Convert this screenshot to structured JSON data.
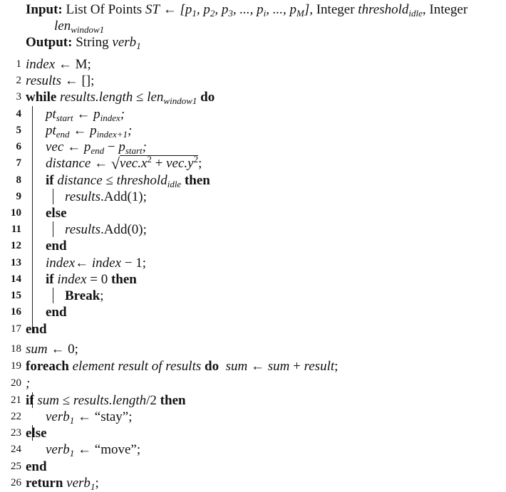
{
  "header": {
    "input_label": "Input:",
    "input_text_1": "List Of Points",
    "input_var_st": "ST",
    "arrow": "←",
    "points_list": "[p",
    "p1_sub": "1",
    "p2": ", p",
    "p2_sub": "2",
    "p3": ", p",
    "p3_sub": "3",
    "p_ellipsis1": ", ..., p",
    "pi_sub": "i",
    "p_ellipsis2": ", ..., p",
    "pm_sub": "M",
    "points_close": "],",
    "input_text_2": "Integer",
    "threshold_var": "threshold",
    "threshold_sub": "idle",
    "comma": ",",
    "input_text_3": "Integer",
    "len_var": "len",
    "len_sub": "window1",
    "output_label": "Output:",
    "output_text": "String",
    "verb_var": "verb",
    "verb_sub": "1"
  },
  "lines": [
    {
      "num": "1",
      "parts": {
        "a": "index",
        "b": "← M;"
      }
    },
    {
      "num": "2",
      "parts": {
        "a": "results",
        "b": "← [];"
      }
    },
    {
      "num": "3",
      "parts": {
        "kw1": "while",
        "a": "results.length",
        "b": "≤",
        "c": "len",
        "c_sub": "window1",
        "kw2": "do"
      }
    },
    {
      "num": "4",
      "parts": {
        "a": "pt",
        "a_sub": "start",
        "b": "←",
        "c": "p",
        "c_sub": "index",
        "d": ";"
      }
    },
    {
      "num": "5",
      "parts": {
        "a": "pt",
        "a_sub": "end",
        "b": "←",
        "c": "p",
        "c_sub": "index+1",
        "d": ";"
      }
    },
    {
      "num": "6",
      "parts": {
        "a": "vec",
        "b": "←",
        "c": "p",
        "c_sub": "end",
        "d": "−",
        "e": "p",
        "e_sub": "start",
        "f": ";"
      }
    },
    {
      "num": "7",
      "parts": {
        "a": "distance",
        "b": "←",
        "c": "vec.x",
        "c_sup": "2",
        "d": "+",
        "e": "vec.y",
        "e_sup": "2",
        "f": ";"
      }
    },
    {
      "num": "8",
      "parts": {
        "kw1": "if",
        "a": "distance",
        "b": "≤",
        "c": "threshold",
        "c_sub": "idle",
        "kw2": "then"
      }
    },
    {
      "num": "9",
      "parts": {
        "a": "results",
        "b": ".Add(1);"
      }
    },
    {
      "num": "10",
      "parts": {
        "kw1": "else"
      }
    },
    {
      "num": "11",
      "parts": {
        "a": "results",
        "b": ".Add(0);"
      }
    },
    {
      "num": "12",
      "parts": {
        "kw1": "end"
      }
    },
    {
      "num": "13",
      "parts": {
        "a": "index",
        "b": "←",
        "c": "index",
        "d": "− 1;"
      }
    },
    {
      "num": "14",
      "parts": {
        "kw1": "if",
        "a": "index",
        "b": "= 0",
        "kw2": "then"
      }
    },
    {
      "num": "15",
      "parts": {
        "kw1": "Break",
        "b": ";"
      }
    },
    {
      "num": "16",
      "parts": {
        "kw1": "end"
      }
    },
    {
      "num": "17",
      "parts": {
        "kw1": "end"
      }
    },
    {
      "num": "18",
      "parts": {
        "a": "sum",
        "b": "← 0;"
      }
    },
    {
      "num": "19",
      "parts": {
        "kw1": "foreach",
        "a": "element result of results",
        "kw2": "do",
        "c": "sum",
        "d": "←",
        "e": "sum",
        "f": "+",
        "g": "result",
        "h": ";"
      }
    },
    {
      "num": "20",
      "parts": {
        "a": ";"
      }
    },
    {
      "num": "21",
      "parts": {
        "kw1": "if",
        "a": "sum",
        "b": "≤",
        "c": "results.length",
        "d": "/2",
        "kw2": "then"
      }
    },
    {
      "num": "22",
      "parts": {
        "a": "verb",
        "a_sub": "1",
        "b": "← “stay”;"
      }
    },
    {
      "num": "23",
      "parts": {
        "kw1": "else"
      }
    },
    {
      "num": "24",
      "parts": {
        "a": "verb",
        "a_sub": "1",
        "b": "← “move”;"
      }
    },
    {
      "num": "25",
      "parts": {
        "kw1": "end"
      }
    },
    {
      "num": "26",
      "parts": {
        "kw1": "return",
        "a": "verb",
        "a_sub": "1",
        "b": ";"
      }
    }
  ]
}
